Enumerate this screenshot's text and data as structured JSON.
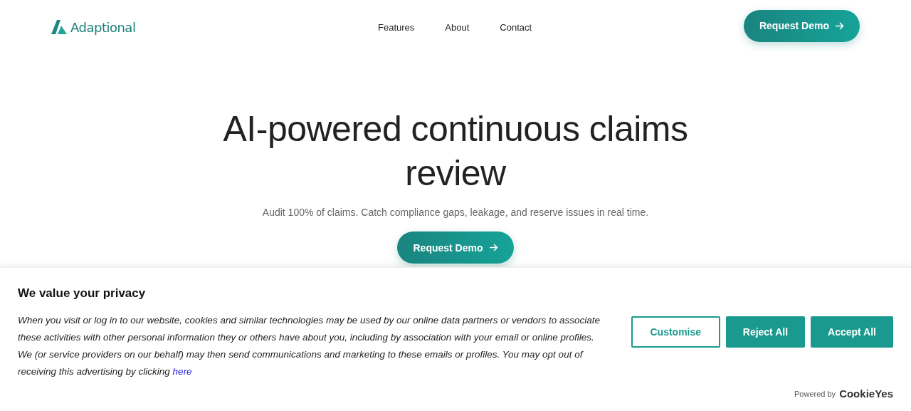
{
  "header": {
    "brand": "Adaptional",
    "nav": [
      {
        "label": "Features"
      },
      {
        "label": "About"
      },
      {
        "label": "Contact"
      }
    ],
    "cta": "Request Demo"
  },
  "hero": {
    "title": "AI-powered continuous claims review",
    "subtitle": "Audit 100% of claims. Catch compliance gaps, leakage, and reserve issues in real time.",
    "cta": "Request Demo"
  },
  "cookie_banner": {
    "title": "We value your privacy",
    "text": "When you visit or log in to our website, cookies and similar technologies may be used by our online data partners or vendors to associate these activities with other personal information they or others have about you, including by association with your email or online profiles. We (or service providers on our behalf) may then send communications and marketing to these emails or profiles. You may opt out of receiving this advertising by clicking",
    "link": "here",
    "buttons": [
      {
        "label": "Customise",
        "kind": "outline"
      },
      {
        "label": "Reject All",
        "kind": "filled"
      },
      {
        "label": "Accept All",
        "kind": "filled"
      }
    ],
    "powered_by": "Powered by",
    "vendor": "CookieYes"
  }
}
